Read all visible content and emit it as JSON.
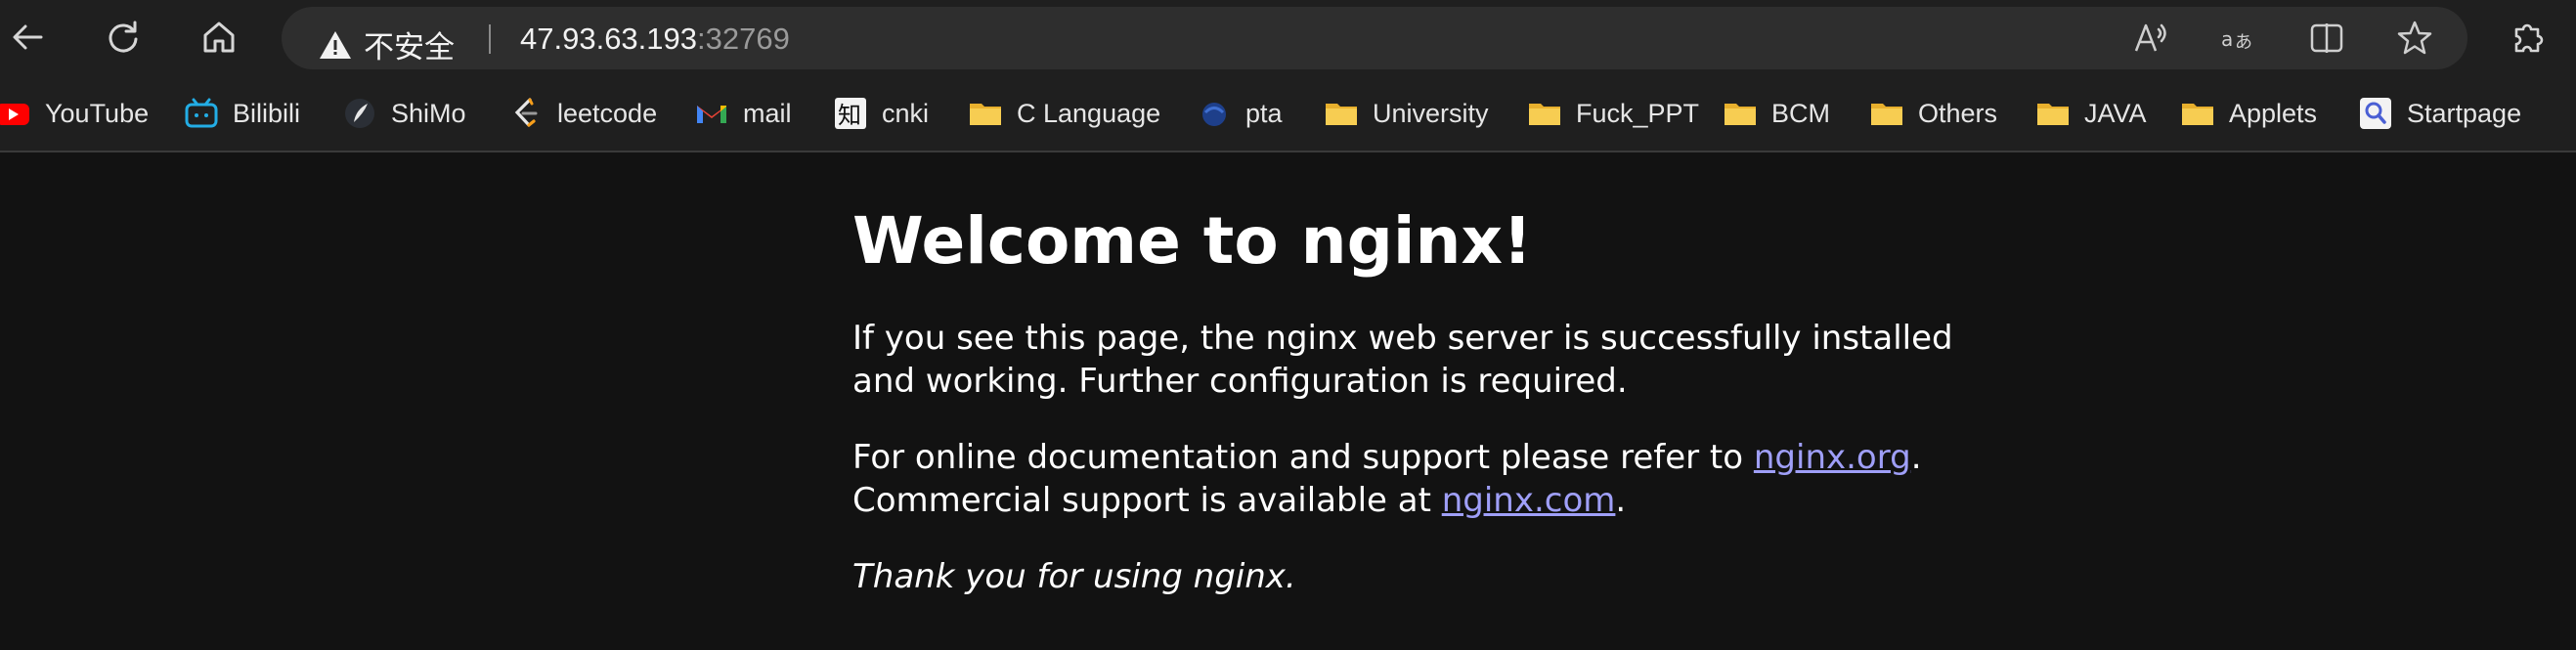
{
  "browser": {
    "security_warning": "不安全",
    "url_host": "47.93.63.193",
    "url_port": ":32769",
    "icons": {
      "back": "back-arrow-icon",
      "refresh": "refresh-icon",
      "home": "home-icon",
      "read_aloud": "read-aloud-icon",
      "translate": "translate-icon",
      "split_screen": "split-screen-icon",
      "favorite": "star-icon",
      "extensions": "puzzle-icon"
    }
  },
  "bookmarks": [
    {
      "label": "YouTube",
      "icon": "youtube-icon"
    },
    {
      "label": "Bilibili",
      "icon": "bilibili-icon"
    },
    {
      "label": "ShiMo",
      "icon": "shimo-icon"
    },
    {
      "label": "leetcode",
      "icon": "leetcode-icon"
    },
    {
      "label": "mail",
      "icon": "gmail-icon"
    },
    {
      "label": "cnki",
      "icon": "cnki-icon"
    },
    {
      "label": "C Language",
      "icon": "folder-icon"
    },
    {
      "label": "pta",
      "icon": "pta-icon"
    },
    {
      "label": "University",
      "icon": "folder-icon"
    },
    {
      "label": "Fuck_PPT",
      "icon": "folder-icon"
    },
    {
      "label": "BCM",
      "icon": "folder-icon"
    },
    {
      "label": "Others",
      "icon": "folder-icon"
    },
    {
      "label": "JAVA",
      "icon": "folder-icon"
    },
    {
      "label": "Applets",
      "icon": "folder-icon"
    },
    {
      "label": "Startpage",
      "icon": "startpage-icon"
    }
  ],
  "page": {
    "heading": "Welcome to nginx!",
    "para1": "If you see this page, the nginx web server is successfully installed and working. Further configuration is required.",
    "para2_prefix": "For online documentation and support please refer to ",
    "link_org": "nginx.org",
    "para2_mid": ".",
    "para2_line2_prefix": "Commercial support is available at ",
    "link_com": "nginx.com",
    "para2_suffix": ".",
    "thanks": "Thank you for using nginx."
  },
  "colors": {
    "page_bg": "#121212",
    "chrome_bg": "#1f1f1f",
    "address_bg": "#2e2e2e",
    "link": "#9f9ff8",
    "folder": "#f5c542"
  }
}
